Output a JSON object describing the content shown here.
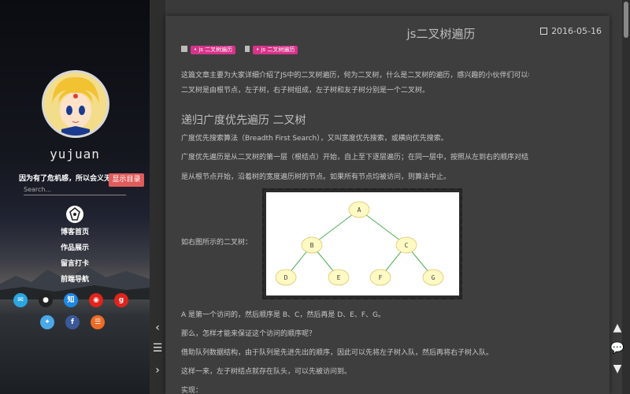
{
  "sidebar": {
    "author": "yujuan",
    "motto": "因为有了危机感，所以会义无反顾",
    "toc_button": "显示目录",
    "search_placeholder": "Search...",
    "nav": [
      "博客首页",
      "作品展示",
      "留言打卡",
      "前端导航"
    ],
    "social_icons": [
      {
        "name": "email-icon",
        "color": "#2ba6e1",
        "glyph": "✉"
      },
      {
        "name": "github-icon",
        "color": "#222222",
        "glyph": "●"
      },
      {
        "name": "zhihu-icon",
        "color": "#1e88e5",
        "glyph": "知"
      },
      {
        "name": "weibo-icon",
        "color": "#e0241c",
        "glyph": "◉"
      },
      {
        "name": "google-plus-icon",
        "color": "#e0241c",
        "glyph": "g"
      },
      {
        "name": "twitter-icon",
        "color": "#4aa8e8",
        "glyph": "✦"
      },
      {
        "name": "facebook-icon",
        "color": "#3b5998",
        "glyph": "f"
      },
      {
        "name": "rss-icon",
        "color": "#ee6b25",
        "glyph": "☰"
      }
    ]
  },
  "article": {
    "title": "js二叉树遍历",
    "date": "2016-05-16",
    "category": "• js 二叉树遍历",
    "tag": "• js 二叉树遍历",
    "intro_1": "这篇文章主要为大家详细介绍了JS中的二叉树遍历，何为二叉树，什么是二叉树的遍历，感兴趣的小伙伴们可以参考一下",
    "intro_2": "二叉树是由根节点，左子树，右子树组成，左子树和友子树分别是一个二叉树。",
    "heading": "递归广度优先遍历 二叉树",
    "p1": "广度优先搜索算法（Breadth First Search），又叫宽度优先搜索，或横向优先搜索。",
    "p2": "广度优先遍历是从二叉树的第一层（根结点）开始，自上至下逐层遍历；在同一层中，按照从左到右的顺序对结点逐一访问。",
    "p3": "是从根节点开始，沿着树的宽度遍历树的节点。如果所有节点均被访问，则算法中止。",
    "figure_caption": "如右图所示的二叉树：",
    "tree_nodes": [
      "A",
      "B",
      "C",
      "D",
      "E",
      "F",
      "G"
    ],
    "p4": "A 是第一个访问的，然后顺序是 B、C，然后再是 D、E、F、G。",
    "p5": "那么，怎样才能来保证这个访问的顺序呢？",
    "p6": "借助队列数据结构，由于队列是先进先出的顺序，因此可以先将左子树入队，然后再将右子树入队。",
    "p7": "这样一来，左子树结点就存在队头，可以先被访问到。",
    "p8": "实现："
  },
  "colors": {
    "tag": "#d6338a",
    "toc_button": "#e05c5c",
    "node_fill": "#fff9c4",
    "edge": "#4caf50"
  }
}
